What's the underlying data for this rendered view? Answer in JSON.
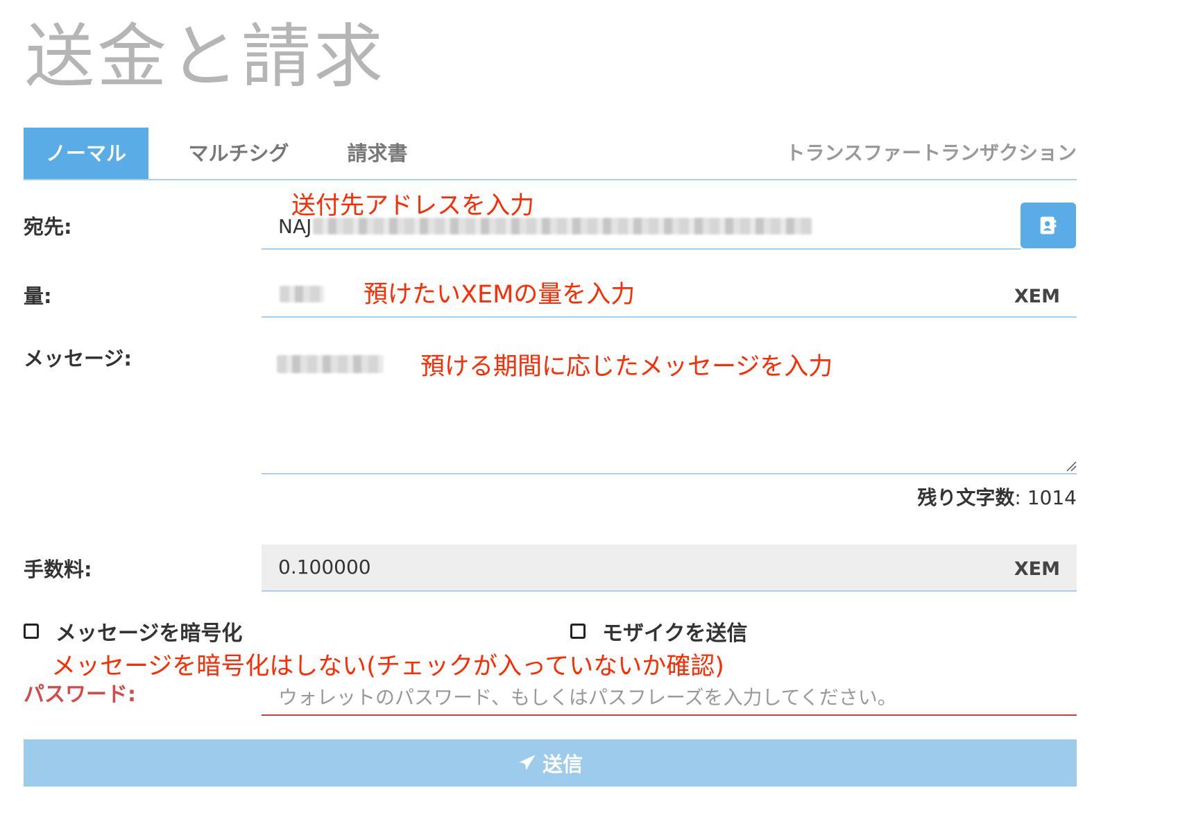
{
  "page": {
    "title": "送金と請求"
  },
  "tabs": {
    "items": [
      {
        "label": "ノーマル",
        "active": true
      },
      {
        "label": "マルチシグ",
        "active": false
      },
      {
        "label": "請求書",
        "active": false
      }
    ],
    "right_label": "トランスファートランザクション"
  },
  "recipient": {
    "label": "宛先:",
    "value_prefix": "NAJ",
    "annotation": "送付先アドレスを入力",
    "button_icon": "address-book-icon"
  },
  "amount": {
    "label": "量:",
    "annotation": "預けたいXEMの量を入力",
    "unit": "XEM"
  },
  "message": {
    "label": "メッセージ:",
    "annotation": "預ける期間に応じたメッセージを入力",
    "counter_label": "残り文字数",
    "counter_value": ": 1014"
  },
  "fee": {
    "label": "手数料:",
    "value": "0.100000",
    "unit": "XEM"
  },
  "options": {
    "encrypt_label": "メッセージを暗号化",
    "mosaic_label": "モザイクを送信",
    "annotation": "メッセージを暗号化はしない(チェックが入っていないか確認)"
  },
  "password": {
    "label": "パスワード:",
    "placeholder": "ウォレットのパスワード、もしくはパスフレーズを入力してください。"
  },
  "submit": {
    "label": "送信",
    "icon": "paper-plane-icon"
  },
  "colors": {
    "accent": "#5aace6",
    "annotation": "#ff2a00",
    "error": "#d24b4b",
    "submit_disabled": "#9ccbec"
  }
}
